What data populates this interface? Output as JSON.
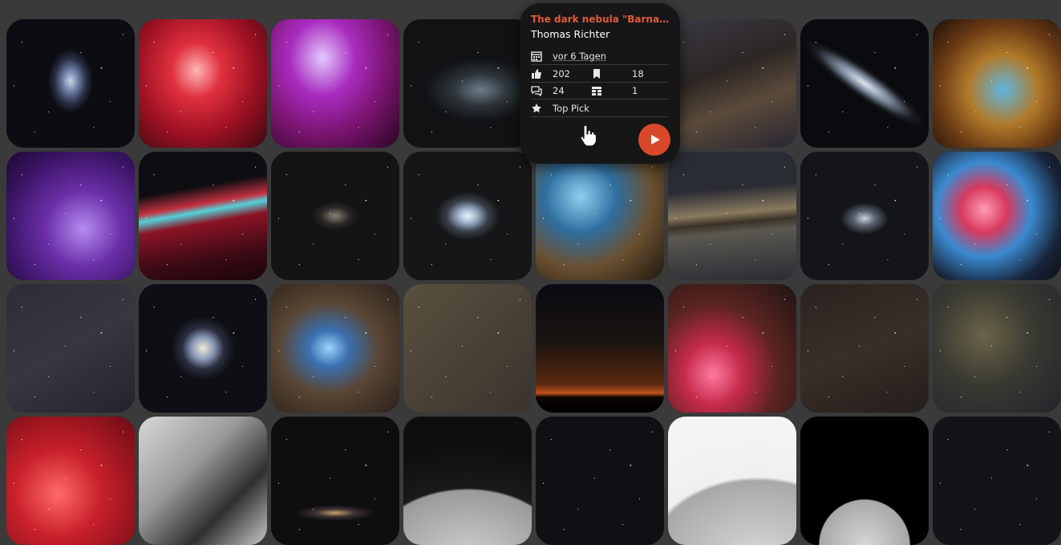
{
  "popup": {
    "title": "The dark nebula \"Barnard...",
    "author": "Thomas Richter",
    "date": "vor 6 Tagen",
    "likes": "202",
    "bookmarks": "18",
    "comments": "24",
    "collections": "1",
    "badge": "Top Pick",
    "accent_color": "#d8492a"
  }
}
